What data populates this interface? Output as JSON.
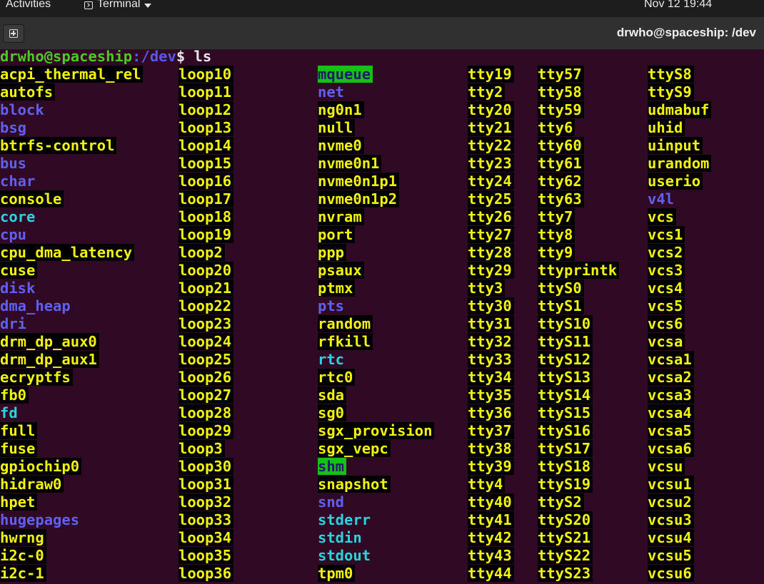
{
  "topbar": {
    "activities": "Activities",
    "app_menu": "Terminal",
    "clock": "Nov 12  19:44"
  },
  "headerbar": {
    "title": "drwho@spaceship: /dev"
  },
  "terminal": {
    "prompt_user": "drwho@spaceship",
    "prompt_path": ":/dev",
    "prompt_symbol": "$ ",
    "command": "ls",
    "columns": [
      [
        {
          "name": "acpi_thermal_rel",
          "type": "chr"
        },
        {
          "name": "autofs",
          "type": "chr"
        },
        {
          "name": "block",
          "type": "dir"
        },
        {
          "name": "bsg",
          "type": "dir"
        },
        {
          "name": "btrfs-control",
          "type": "chr"
        },
        {
          "name": "bus",
          "type": "dir"
        },
        {
          "name": "char",
          "type": "dir"
        },
        {
          "name": "console",
          "type": "chr"
        },
        {
          "name": "core",
          "type": "lnk"
        },
        {
          "name": "cpu",
          "type": "dir"
        },
        {
          "name": "cpu_dma_latency",
          "type": "chr"
        },
        {
          "name": "cuse",
          "type": "chr"
        },
        {
          "name": "disk",
          "type": "dir"
        },
        {
          "name": "dma_heap",
          "type": "dir"
        },
        {
          "name": "dri",
          "type": "dir"
        },
        {
          "name": "drm_dp_aux0",
          "type": "chr"
        },
        {
          "name": "drm_dp_aux1",
          "type": "chr"
        },
        {
          "name": "ecryptfs",
          "type": "chr"
        },
        {
          "name": "fb0",
          "type": "chr"
        },
        {
          "name": "fd",
          "type": "lnk"
        },
        {
          "name": "full",
          "type": "chr"
        },
        {
          "name": "fuse",
          "type": "chr"
        },
        {
          "name": "gpiochip0",
          "type": "chr"
        },
        {
          "name": "hidraw0",
          "type": "chr"
        },
        {
          "name": "hpet",
          "type": "chr"
        },
        {
          "name": "hugepages",
          "type": "dir"
        },
        {
          "name": "hwrng",
          "type": "chr"
        },
        {
          "name": "i2c-0",
          "type": "chr"
        },
        {
          "name": "i2c-1",
          "type": "chr"
        }
      ],
      [
        {
          "name": "loop10",
          "type": "chr"
        },
        {
          "name": "loop11",
          "type": "chr"
        },
        {
          "name": "loop12",
          "type": "chr"
        },
        {
          "name": "loop13",
          "type": "chr"
        },
        {
          "name": "loop14",
          "type": "chr"
        },
        {
          "name": "loop15",
          "type": "chr"
        },
        {
          "name": "loop16",
          "type": "chr"
        },
        {
          "name": "loop17",
          "type": "chr"
        },
        {
          "name": "loop18",
          "type": "chr"
        },
        {
          "name": "loop19",
          "type": "chr"
        },
        {
          "name": "loop2",
          "type": "chr"
        },
        {
          "name": "loop20",
          "type": "chr"
        },
        {
          "name": "loop21",
          "type": "chr"
        },
        {
          "name": "loop22",
          "type": "chr"
        },
        {
          "name": "loop23",
          "type": "chr"
        },
        {
          "name": "loop24",
          "type": "chr"
        },
        {
          "name": "loop25",
          "type": "chr"
        },
        {
          "name": "loop26",
          "type": "chr"
        },
        {
          "name": "loop27",
          "type": "chr"
        },
        {
          "name": "loop28",
          "type": "chr"
        },
        {
          "name": "loop29",
          "type": "chr"
        },
        {
          "name": "loop3",
          "type": "chr"
        },
        {
          "name": "loop30",
          "type": "chr"
        },
        {
          "name": "loop31",
          "type": "chr"
        },
        {
          "name": "loop32",
          "type": "chr"
        },
        {
          "name": "loop33",
          "type": "chr"
        },
        {
          "name": "loop34",
          "type": "chr"
        },
        {
          "name": "loop35",
          "type": "chr"
        },
        {
          "name": "loop36",
          "type": "chr"
        }
      ],
      [
        {
          "name": "mqueue",
          "type": "sticky"
        },
        {
          "name": "net",
          "type": "dir"
        },
        {
          "name": "ng0n1",
          "type": "chr"
        },
        {
          "name": "null",
          "type": "chr"
        },
        {
          "name": "nvme0",
          "type": "chr"
        },
        {
          "name": "nvme0n1",
          "type": "chr"
        },
        {
          "name": "nvme0n1p1",
          "type": "chr"
        },
        {
          "name": "nvme0n1p2",
          "type": "chr"
        },
        {
          "name": "nvram",
          "type": "chr"
        },
        {
          "name": "port",
          "type": "chr"
        },
        {
          "name": "ppp",
          "type": "chr"
        },
        {
          "name": "psaux",
          "type": "chr"
        },
        {
          "name": "ptmx",
          "type": "chr"
        },
        {
          "name": "pts",
          "type": "dir"
        },
        {
          "name": "random",
          "type": "chr"
        },
        {
          "name": "rfkill",
          "type": "chr"
        },
        {
          "name": "rtc",
          "type": "lnk"
        },
        {
          "name": "rtc0",
          "type": "chr"
        },
        {
          "name": "sda",
          "type": "chr"
        },
        {
          "name": "sg0",
          "type": "chr"
        },
        {
          "name": "sgx_provision",
          "type": "chr"
        },
        {
          "name": "sgx_vepc",
          "type": "chr"
        },
        {
          "name": "shm",
          "type": "sticky"
        },
        {
          "name": "snapshot",
          "type": "chr"
        },
        {
          "name": "snd",
          "type": "dir"
        },
        {
          "name": "stderr",
          "type": "lnk"
        },
        {
          "name": "stdin",
          "type": "lnk"
        },
        {
          "name": "stdout",
          "type": "lnk"
        },
        {
          "name": "tpm0",
          "type": "chr"
        }
      ],
      [
        {
          "name": "tty19",
          "type": "chr"
        },
        {
          "name": "tty2",
          "type": "chr"
        },
        {
          "name": "tty20",
          "type": "chr"
        },
        {
          "name": "tty21",
          "type": "chr"
        },
        {
          "name": "tty22",
          "type": "chr"
        },
        {
          "name": "tty23",
          "type": "chr"
        },
        {
          "name": "tty24",
          "type": "chr"
        },
        {
          "name": "tty25",
          "type": "chr"
        },
        {
          "name": "tty26",
          "type": "chr"
        },
        {
          "name": "tty27",
          "type": "chr"
        },
        {
          "name": "tty28",
          "type": "chr"
        },
        {
          "name": "tty29",
          "type": "chr"
        },
        {
          "name": "tty3",
          "type": "chr"
        },
        {
          "name": "tty30",
          "type": "chr"
        },
        {
          "name": "tty31",
          "type": "chr"
        },
        {
          "name": "tty32",
          "type": "chr"
        },
        {
          "name": "tty33",
          "type": "chr"
        },
        {
          "name": "tty34",
          "type": "chr"
        },
        {
          "name": "tty35",
          "type": "chr"
        },
        {
          "name": "tty36",
          "type": "chr"
        },
        {
          "name": "tty37",
          "type": "chr"
        },
        {
          "name": "tty38",
          "type": "chr"
        },
        {
          "name": "tty39",
          "type": "chr"
        },
        {
          "name": "tty4",
          "type": "chr"
        },
        {
          "name": "tty40",
          "type": "chr"
        },
        {
          "name": "tty41",
          "type": "chr"
        },
        {
          "name": "tty42",
          "type": "chr"
        },
        {
          "name": "tty43",
          "type": "chr"
        },
        {
          "name": "tty44",
          "type": "chr"
        }
      ],
      [
        {
          "name": "tty57",
          "type": "chr"
        },
        {
          "name": "tty58",
          "type": "chr"
        },
        {
          "name": "tty59",
          "type": "chr"
        },
        {
          "name": "tty6",
          "type": "chr"
        },
        {
          "name": "tty60",
          "type": "chr"
        },
        {
          "name": "tty61",
          "type": "chr"
        },
        {
          "name": "tty62",
          "type": "chr"
        },
        {
          "name": "tty63",
          "type": "chr"
        },
        {
          "name": "tty7",
          "type": "chr"
        },
        {
          "name": "tty8",
          "type": "chr"
        },
        {
          "name": "tty9",
          "type": "chr"
        },
        {
          "name": "ttyprintk",
          "type": "chr"
        },
        {
          "name": "ttyS0",
          "type": "chr"
        },
        {
          "name": "ttyS1",
          "type": "chr"
        },
        {
          "name": "ttyS10",
          "type": "chr"
        },
        {
          "name": "ttyS11",
          "type": "chr"
        },
        {
          "name": "ttyS12",
          "type": "chr"
        },
        {
          "name": "ttyS13",
          "type": "chr"
        },
        {
          "name": "ttyS14",
          "type": "chr"
        },
        {
          "name": "ttyS15",
          "type": "chr"
        },
        {
          "name": "ttyS16",
          "type": "chr"
        },
        {
          "name": "ttyS17",
          "type": "chr"
        },
        {
          "name": "ttyS18",
          "type": "chr"
        },
        {
          "name": "ttyS19",
          "type": "chr"
        },
        {
          "name": "ttyS2",
          "type": "chr"
        },
        {
          "name": "ttyS20",
          "type": "chr"
        },
        {
          "name": "ttyS21",
          "type": "chr"
        },
        {
          "name": "ttyS22",
          "type": "chr"
        },
        {
          "name": "ttyS23",
          "type": "chr"
        }
      ],
      [
        {
          "name": "ttyS8",
          "type": "chr"
        },
        {
          "name": "ttyS9",
          "type": "chr"
        },
        {
          "name": "udmabuf",
          "type": "chr"
        },
        {
          "name": "uhid",
          "type": "chr"
        },
        {
          "name": "uinput",
          "type": "chr"
        },
        {
          "name": "urandom",
          "type": "chr"
        },
        {
          "name": "userio",
          "type": "chr"
        },
        {
          "name": "v4l",
          "type": "dir"
        },
        {
          "name": "vcs",
          "type": "chr"
        },
        {
          "name": "vcs1",
          "type": "chr"
        },
        {
          "name": "vcs2",
          "type": "chr"
        },
        {
          "name": "vcs3",
          "type": "chr"
        },
        {
          "name": "vcs4",
          "type": "chr"
        },
        {
          "name": "vcs5",
          "type": "chr"
        },
        {
          "name": "vcs6",
          "type": "chr"
        },
        {
          "name": "vcsa",
          "type": "chr"
        },
        {
          "name": "vcsa1",
          "type": "chr"
        },
        {
          "name": "vcsa2",
          "type": "chr"
        },
        {
          "name": "vcsa3",
          "type": "chr"
        },
        {
          "name": "vcsa4",
          "type": "chr"
        },
        {
          "name": "vcsa5",
          "type": "chr"
        },
        {
          "name": "vcsa6",
          "type": "chr"
        },
        {
          "name": "vcsu",
          "type": "chr"
        },
        {
          "name": "vcsu1",
          "type": "chr"
        },
        {
          "name": "vcsu2",
          "type": "chr"
        },
        {
          "name": "vcsu3",
          "type": "chr"
        },
        {
          "name": "vcsu4",
          "type": "chr"
        },
        {
          "name": "vcsu5",
          "type": "chr"
        },
        {
          "name": "vcsu6",
          "type": "chr"
        }
      ]
    ]
  },
  "colors": {
    "terminal_bg": "#300a24",
    "char_device_fg": "#f2f20c",
    "directory_fg": "#6060f0",
    "symlink_fg": "#2ad4de",
    "sticky_dir_bg": "#17c017",
    "prompt_user_fg": "#4ec926"
  },
  "icons": {
    "app_menu_icon": "terminal-icon",
    "new_tab_icon": "new-tab-icon"
  }
}
